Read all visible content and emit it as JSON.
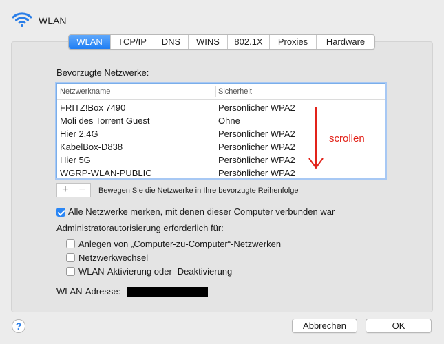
{
  "window": {
    "title": "WLAN",
    "icon": "wifi-icon"
  },
  "tabs": [
    {
      "label": "WLAN",
      "active": true
    },
    {
      "label": "TCP/IP",
      "active": false
    },
    {
      "label": "DNS",
      "active": false
    },
    {
      "label": "WINS",
      "active": false
    },
    {
      "label": "802.1X",
      "active": false
    },
    {
      "label": "Proxies",
      "active": false
    },
    {
      "label": "Hardware",
      "active": false
    }
  ],
  "networks": {
    "section_label": "Bevorzugte Netzwerke:",
    "columns": [
      "Netzwerkname",
      "Sicherheit"
    ],
    "rows": [
      {
        "name": "FRITZ!Box 7490",
        "security": "Persönlicher WPA2"
      },
      {
        "name": "Moli des Torrent Guest",
        "security": "Ohne"
      },
      {
        "name": "Hier 2,4G",
        "security": "Persönlicher WPA2"
      },
      {
        "name": "KabelBox-D838",
        "security": "Persönlicher WPA2"
      },
      {
        "name": "Hier 5G",
        "security": "Persönlicher WPA2"
      },
      {
        "name": "WGRP-WLAN-PUBLIC",
        "security": "Persönlicher WPA2"
      }
    ],
    "annotation": "scrollen",
    "add_label": "+",
    "remove_label": "−",
    "reorder_hint": "Bewegen Sie die Netzwerke in Ihre bevorzugte Reihenfolge"
  },
  "remember": {
    "label": "Alle Netzwerke merken, mit denen dieser Computer verbunden war",
    "checked": true
  },
  "admin": {
    "label": "Administratorautorisierung erforderlich für:",
    "options": [
      {
        "label": "Anlegen von „Computer-zu-Computer“-Netzwerken",
        "checked": false
      },
      {
        "label": "Netzwerkwechsel",
        "checked": false
      },
      {
        "label": "WLAN-Aktivierung oder -Deaktivierung",
        "checked": false
      }
    ]
  },
  "address": {
    "label": "WLAN-Adresse:"
  },
  "footer": {
    "help": "?",
    "cancel": "Abbrechen",
    "ok": "OK"
  },
  "colors": {
    "accent": "#2a86f5",
    "annotation": "#e2231a"
  }
}
